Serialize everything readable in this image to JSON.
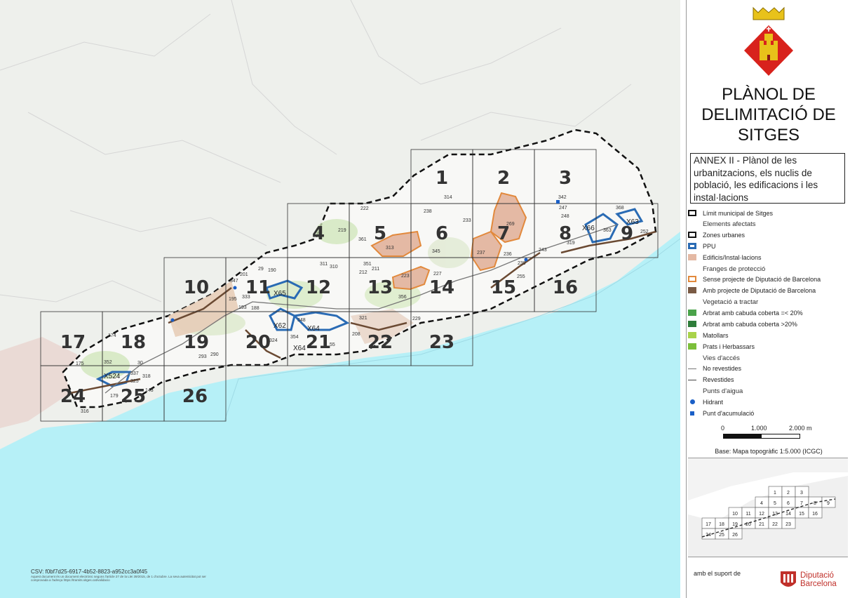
{
  "title": "PLÀNOL DE DELIMITACIÓ DE SITGES",
  "title_lines": [
    "PLÀNOL DE",
    "DELIMITACIÓ DE",
    "SITGES"
  ],
  "annex": "ANNEX II - Plànol de les urbanitzacions, els nuclis de població, les edificacions i les instal·lacions",
  "legend": {
    "municipal_limit": "Límit municipal de Sitges",
    "affected_heading": "Elements afectats",
    "urban_zones": "Zones urbanes",
    "ppu": "PPU",
    "buildings": "Edificis/Instal·lacions",
    "protection_heading": "Franges de protecció",
    "no_project": "Sense projecte de Diputació de Barcelona",
    "with_project": "Amb projecte de Diputació de Barcelona",
    "vegetation_heading": "Vegetació a tractar",
    "trees_low": "Arbrat amb cabuda coberta =< 20%",
    "trees_high": "Arbrat amb cabuda coberta >20%",
    "scrub": "Matollars",
    "grass": "Prats i Herbassars",
    "access_heading": "Vies d'accés",
    "unpaved": "No revestides",
    "paved": "Revestides",
    "water_heading": "Punts d'aigua",
    "hydrant": "Hidrant",
    "storage": "Punt d'acumulació"
  },
  "scale_labels": [
    "0",
    "1.000",
    "2.000 m"
  ],
  "base_text": "Base: Mapa topogràfic 1:5.000 (ICGC)",
  "support_text": "amb el suport de",
  "diputacio_text": "Diputació\nBarcelona",
  "csv_text": "CSV: f0bf7d25-6917-4b52-8823-a952cc3a0f45",
  "csv_note": "Aquest document és un document electrònic segons l'article 27 de la Llei 39/2015, de 1 d'octubre. La seva autenticitat pot ser comprovada a l'adreça https://tramits.sitges.cat/validacio",
  "sheets": [
    "1",
    "2",
    "3",
    "4",
    "5",
    "6",
    "7",
    "8",
    "9",
    "10",
    "11",
    "12",
    "13",
    "14",
    "15",
    "16",
    "17",
    "18",
    "19",
    "20",
    "21",
    "22",
    "23",
    "24",
    "25",
    "26"
  ],
  "ppu_labels": [
    "X66",
    "X63",
    "X65",
    "X62",
    "X64",
    "X64",
    "X524"
  ],
  "site_numbers": [
    "314",
    "238",
    "233",
    "222",
    "219",
    "361",
    "313",
    "345",
    "269",
    "237",
    "236",
    "342",
    "247",
    "248",
    "243",
    "319",
    "368",
    "363",
    "252",
    "239",
    "255",
    "227",
    "223",
    "356",
    "351",
    "212",
    "211",
    "311",
    "310",
    "347",
    "201",
    "29",
    "190",
    "195",
    "333",
    "193",
    "188",
    "348",
    "354",
    "324",
    "321",
    "208",
    "229",
    "174",
    "352",
    "30",
    "337",
    "318",
    "325",
    "143",
    "179",
    "175",
    "316",
    "293",
    "290",
    "55"
  ],
  "colors": {
    "sea": "#b6f0f7",
    "land": "#eef0ec",
    "municipality": "#f8f8f6",
    "ppu": "#2a6bb4",
    "building": "#e4b9a4",
    "building_edge": "#e2893c",
    "diputacio_red": "#c0302a"
  }
}
